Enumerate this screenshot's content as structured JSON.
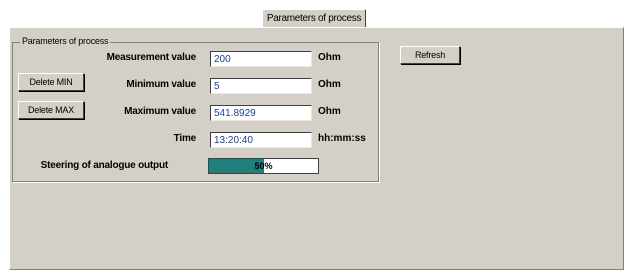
{
  "tab": {
    "label": "Parameters of process"
  },
  "group": {
    "title": "Parameters of process"
  },
  "buttons": {
    "delete_min": "Delete MIN",
    "delete_max": "Delete MAX",
    "refresh": "Refresh"
  },
  "fields": {
    "measurement": {
      "label": "Measurement value",
      "value": "200",
      "unit": "Ohm"
    },
    "minimum": {
      "label": "Minimum value",
      "value": "5",
      "unit": "Ohm"
    },
    "maximum": {
      "label": "Maximum value",
      "value": "541.8929",
      "unit": "Ohm"
    },
    "time": {
      "label": "Time",
      "value": "13:20:40",
      "unit": "hh:mm:ss"
    }
  },
  "analogue_output": {
    "label": "Steering of analogue output",
    "percent": 50,
    "text": "50%",
    "fill_color": "#1f7f7a"
  }
}
